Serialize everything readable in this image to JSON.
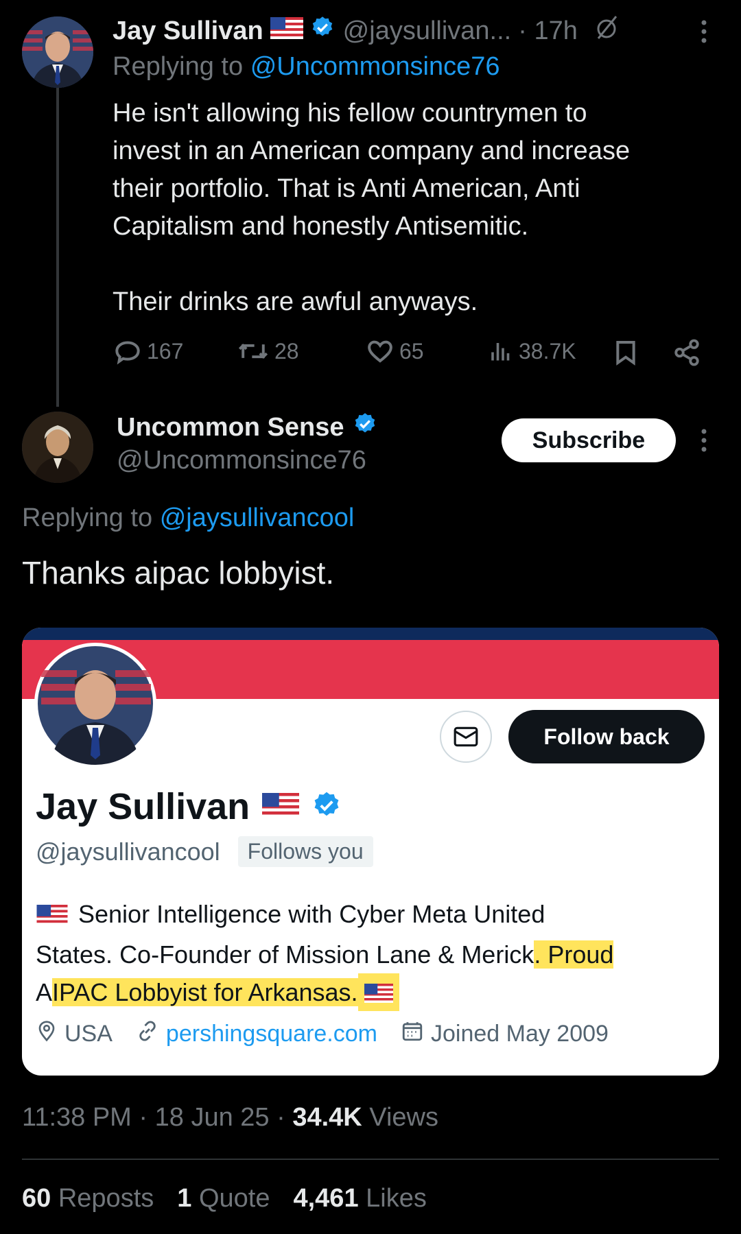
{
  "tweet1": {
    "author_name": "Jay Sullivan",
    "handle": "@jaysullivan...",
    "time": "· 17h",
    "replying_prefix": "Replying to",
    "replying_to": "@Uncommonsince76",
    "body_lines": [
      "He isn't allowing his fellow countrymen to",
      "invest in an American company and increase",
      "their portfolio. That is Anti American, Anti",
      "Capitalism and honestly Antisemitic."
    ],
    "body_line2": "Their drinks are awful anyways.",
    "replies": "167",
    "reposts": "28",
    "likes": "65",
    "views": "38.7K"
  },
  "tweet2": {
    "author_name": "Uncommon Sense",
    "handle": "@Uncommonsince76",
    "subscribe_label": "Subscribe",
    "replying_prefix": "Replying to",
    "replying_to": "@jaysullivancool",
    "body": "Thanks aipac lobbyist."
  },
  "profile_card": {
    "follow_back_label": "Follow back",
    "name": "Jay Sullivan",
    "handle": "@jaysullivancool",
    "follows_you": "Follows you",
    "bio_line1": "Senior Intelligence with Cyber Meta United",
    "bio_line2_a": "States. Co-Founder of Mission Lane & Merick",
    "bio_line2_b": ". Proud",
    "bio_line3_a": "A",
    "bio_line3_b": "IPAC Lobbyist for Arkansas.",
    "location": "USA",
    "website": "pershingsquare.com",
    "joined": "Joined May 2009",
    "highlight_color": "#ffe45c"
  },
  "footer": {
    "time": "11:38 PM",
    "date": "18 Jun 25",
    "views_count": "34.4K",
    "views_label": "Views",
    "reposts_count": "60",
    "reposts_label": "Reposts",
    "quotes_count": "1",
    "quotes_label": "Quote",
    "likes_count": "4,461",
    "likes_label": "Likes"
  },
  "colors": {
    "background": "#000000",
    "link": "#1d9bf0",
    "verified": "#1d9bf0",
    "muted": "#71767b"
  }
}
